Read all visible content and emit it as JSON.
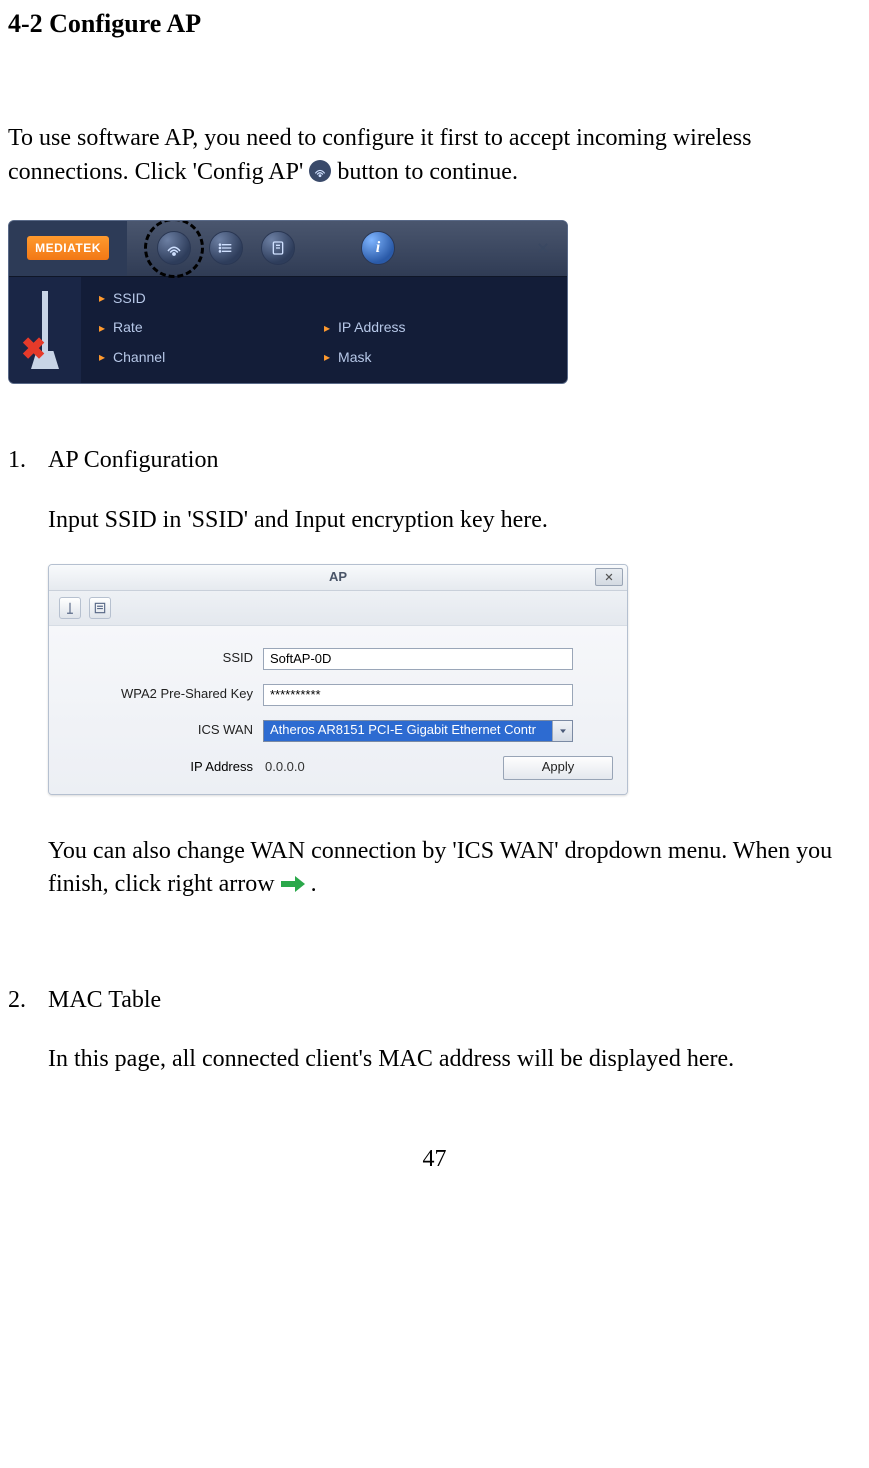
{
  "heading": "4-2 Configure AP",
  "intro": {
    "part1": "To use software AP, you need to configure it first to accept incoming wireless connections. Click 'Config AP' ",
    "part2": " button to continue."
  },
  "panel1": {
    "logo": "MEDIATEK",
    "fields": {
      "ssid": "SSID",
      "rate": "Rate",
      "channel": "Channel",
      "ip": "IP Address",
      "mask": "Mask"
    }
  },
  "step1": {
    "num": "1.",
    "title": "AP Configuration",
    "desc": "Input SSID in 'SSID' and Input encryption key here.",
    "after1": "You can also change WAN connection by 'ICS WAN' dropdown menu. When you finish, click right arrow ",
    "after2": " ."
  },
  "panel2": {
    "title": "AP",
    "labels": {
      "ssid": "SSID",
      "wpa": "WPA2 Pre-Shared Key",
      "ics": "ICS WAN",
      "ip": "IP Address"
    },
    "values": {
      "ssid": "SoftAP-0D",
      "wpa": "**********",
      "ics": "Atheros AR8151 PCI-E Gigabit Ethernet Contr",
      "ip": "0.0.0.0"
    },
    "apply": "Apply"
  },
  "step2": {
    "num": "2.",
    "title": "MAC Table",
    "desc": "In this page, all connected client's MAC address will be displayed here."
  },
  "page_number": "47"
}
